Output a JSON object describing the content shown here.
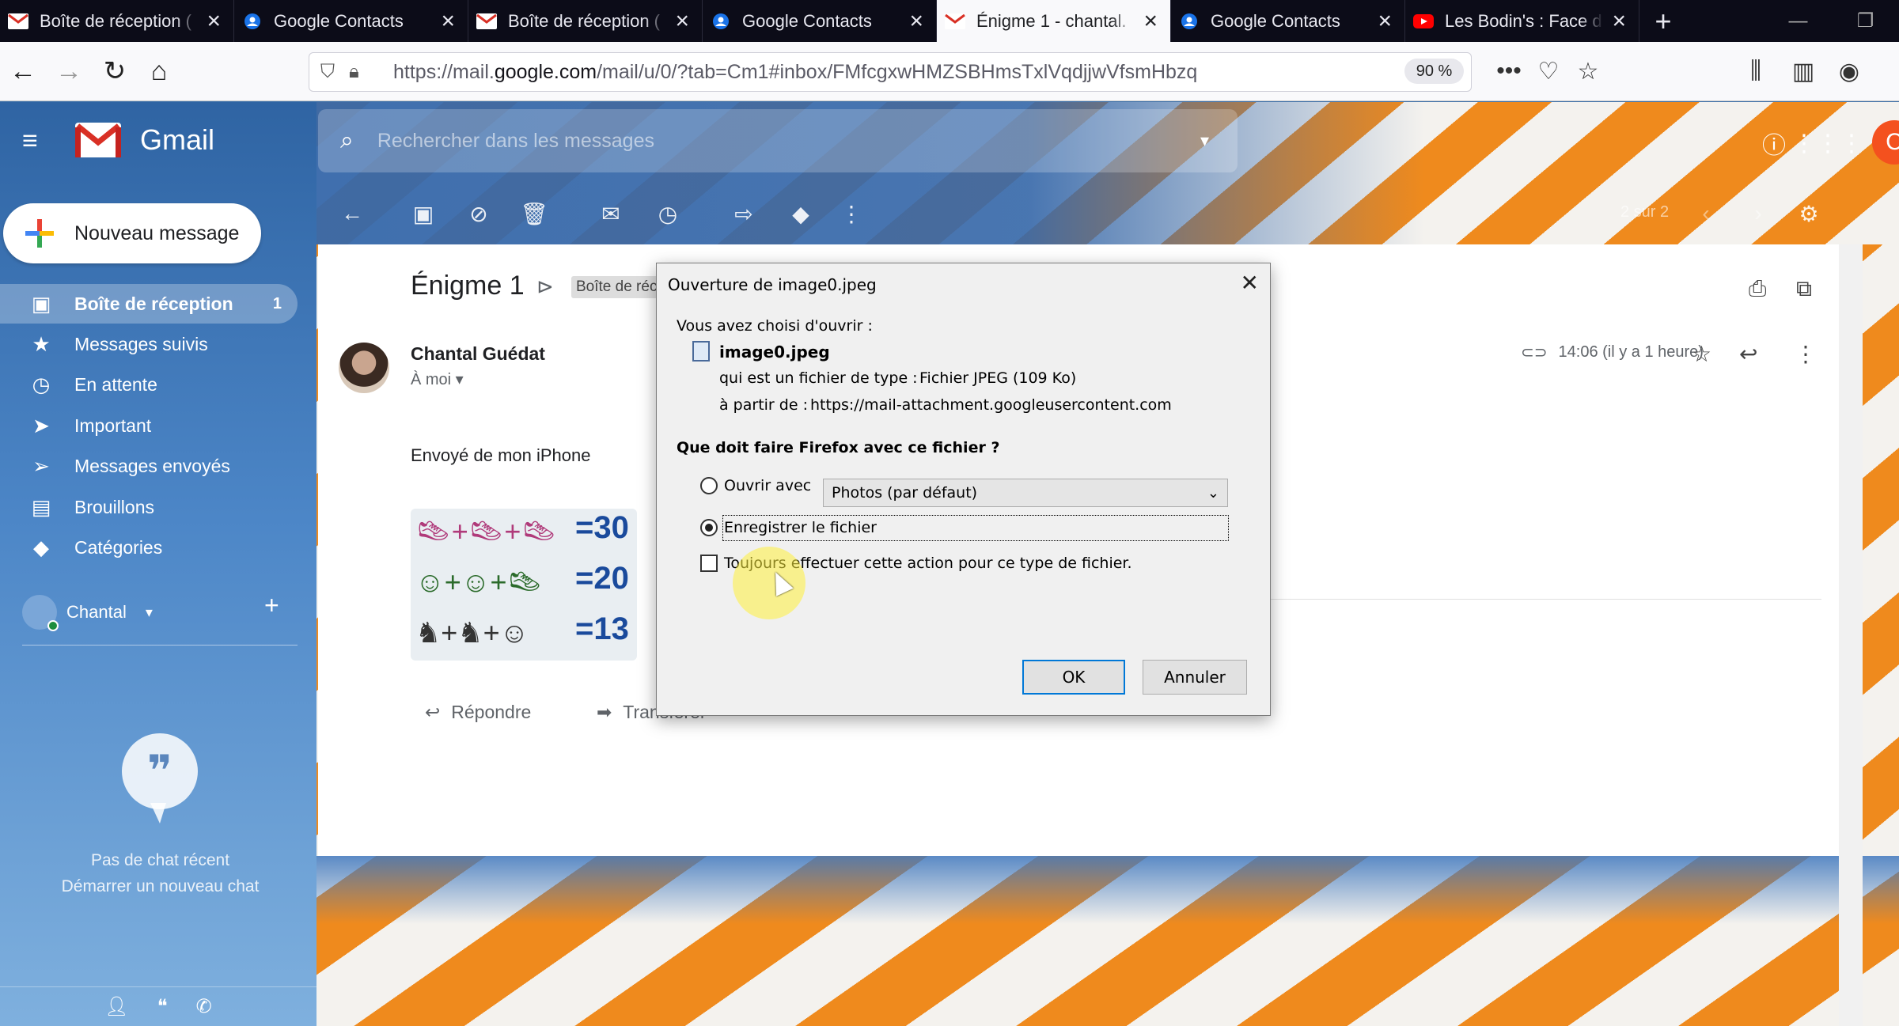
{
  "browser": {
    "tabs": [
      {
        "title": "Boîte de réception (",
        "favicon": "gmail-icon",
        "active": false
      },
      {
        "title": "Google Contacts",
        "favicon": "contacts-icon",
        "active": false
      },
      {
        "title": "Boîte de réception (",
        "favicon": "gmail-icon",
        "active": false
      },
      {
        "title": "Google Contacts",
        "favicon": "contacts-icon",
        "active": false
      },
      {
        "title": "Énigme 1 - chantal.",
        "favicon": "gmail-icon",
        "active": true
      },
      {
        "title": "Google Contacts",
        "favicon": "contacts-icon",
        "active": false
      },
      {
        "title": "Les Bodin's : Face d",
        "favicon": "youtube-icon",
        "active": false
      }
    ],
    "url_prefix": "https://mail.",
    "url_domain": "google.com",
    "url_rest": "/mail/u/0/?tab=Cm1#inbox/FMfcgxwHMZSBHmsTxlVqdjjwVfsmHbzq",
    "zoom": "90 %"
  },
  "gmail": {
    "brand": "Gmail",
    "search_placeholder": "Rechercher dans les messages",
    "pager": "2 sur 2",
    "account_initial": "C",
    "compose_label": "Nouveau message",
    "nav": [
      {
        "label": "Boîte de réception",
        "count": "1",
        "icon": "inbox-icon",
        "glyph": "▣",
        "selected": true
      },
      {
        "label": "Messages suivis",
        "count": "",
        "icon": "star-icon",
        "glyph": "★",
        "selected": false
      },
      {
        "label": "En attente",
        "count": "",
        "icon": "clock-icon",
        "glyph": "◷",
        "selected": false
      },
      {
        "label": "Important",
        "count": "",
        "icon": "important-icon",
        "glyph": "➤",
        "selected": false
      },
      {
        "label": "Messages envoyés",
        "count": "",
        "icon": "send-icon",
        "glyph": "➢",
        "selected": false
      },
      {
        "label": "Brouillons",
        "count": "",
        "icon": "draft-icon",
        "glyph": "▤",
        "selected": false
      },
      {
        "label": "Catégories",
        "count": "",
        "icon": "label-icon",
        "glyph": "◆",
        "selected": false
      }
    ],
    "hangouts_user": "Chantal",
    "chat_empty_line1": "Pas de chat récent",
    "chat_empty_line2": "Démarrer un nouveau chat",
    "message": {
      "subject": "Énigme 1",
      "label_chip": "Boîte de réc",
      "sender": "Chantal Guédat",
      "to": "À moi",
      "time": "14:06 (il y a 1 heure)",
      "body": "Envoyé de mon iPhone",
      "puzzle_values": [
        "=30",
        "=20",
        "=13"
      ],
      "reply": "Répondre",
      "forward": "Transférer"
    }
  },
  "dialog": {
    "title": "Ouverture de image0.jpeg",
    "chosen_label": "Vous avez choisi d'ouvrir :",
    "filename": "image0.jpeg",
    "type_label": "qui est un fichier de type :",
    "type_value": "Fichier JPEG (109 Ko)",
    "from_label": "à partir de :",
    "from_value": "https://mail-attachment.googleusercontent.com",
    "question": "Que doit faire Firefox avec ce fichier ?",
    "open_with_label": "Ouvrir avec",
    "open_with_value": "Photos (par défaut)",
    "save_label": "Enregistrer le fichier",
    "always_label": "Toujours effectuer cette action pour ce type de fichier.",
    "ok": "OK",
    "cancel": "Annuler",
    "selected_option": "save"
  }
}
